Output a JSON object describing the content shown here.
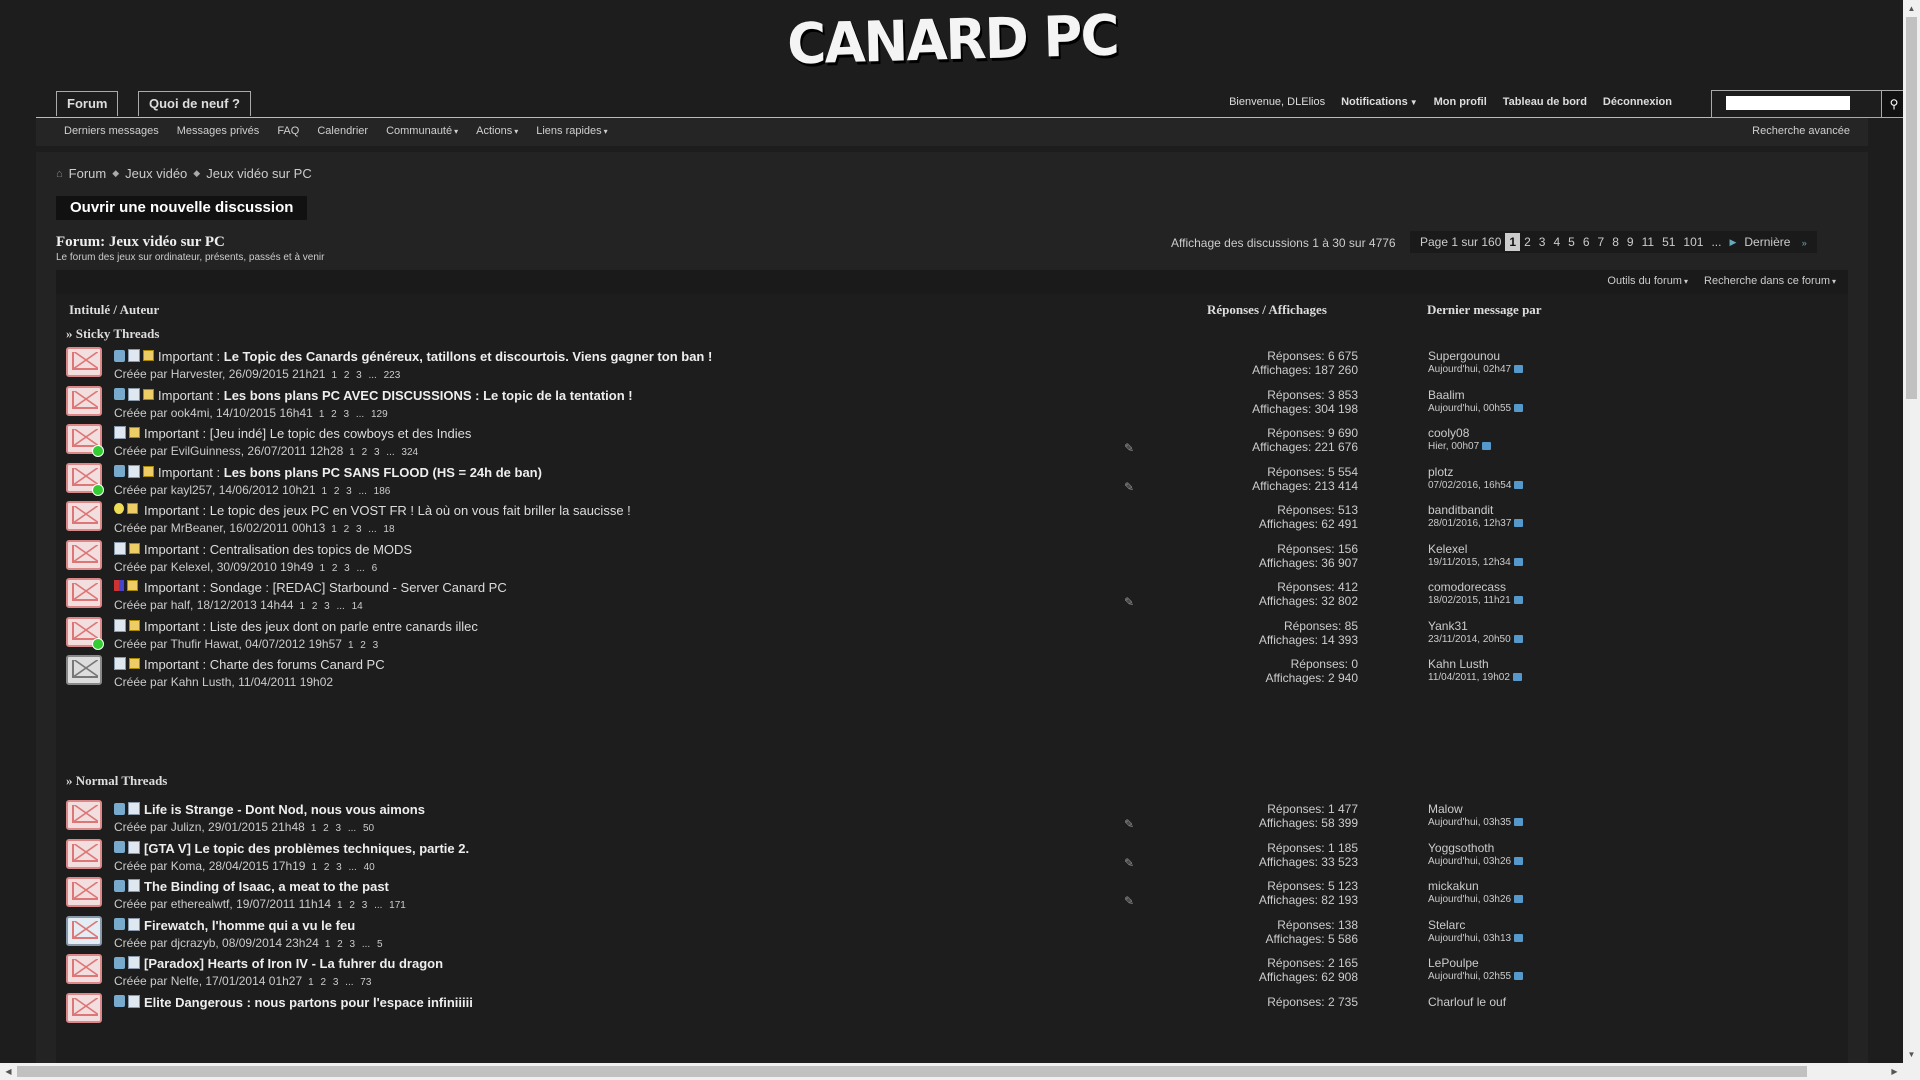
{
  "logo": "CANARD PC",
  "nav": {
    "tabs": [
      "Forum",
      "Quoi de neuf ?"
    ],
    "welcome": "Bienvenue,",
    "username": "DLElios",
    "notifications": "Notifications",
    "profile": "Mon profil",
    "dashboard": "Tableau de bord",
    "logout": "Déconnexion"
  },
  "subnav": {
    "items": [
      "Derniers messages",
      "Messages privés",
      "FAQ",
      "Calendrier",
      "Communauté",
      "Actions",
      "Liens rapides"
    ],
    "advanced_search": "Recherche avancée"
  },
  "breadcrumb": [
    "Forum",
    "Jeux vidéo",
    "Jeux vidéo sur PC"
  ],
  "new_thread_button": "Ouvrir une nouvelle discussion",
  "forum": {
    "title": "Forum: Jeux vidéo sur PC",
    "description": "Le forum des jeux sur ordinateur, présents, passés et à venir",
    "displaying": "Affichage des discussions 1 à 30 sur 4776"
  },
  "pagination": {
    "label": "Page 1 sur 160",
    "pages": [
      "1",
      "2",
      "3",
      "4",
      "5",
      "6",
      "7",
      "8",
      "9",
      "11",
      "51",
      "101"
    ],
    "ellipsis": "...",
    "last": "Dernière"
  },
  "tools": {
    "forum_tools": "Outils du forum",
    "search_forum": "Recherche dans ce forum"
  },
  "columns": {
    "title": "Intitulé / Auteur",
    "stats": "Réponses / Affichages",
    "last": "Dernier message par"
  },
  "sections": {
    "sticky": "» Sticky Threads",
    "normal": "» Normal Threads"
  },
  "sticky_threads": [
    {
      "prefix": "Important : ",
      "title": "Le Topic des Canards généreux, tatillons et discourtois. Viens gagner ton ban !",
      "bold": true,
      "meta": "Créée par Harvester, 26/09/2015 21h21",
      "pages": "1 2 3 ... 223",
      "replies": "Réponses: 6 675",
      "views": "Affichages: 187 260",
      "last_user": "Supergounou",
      "last_time": "Aujourd'hui, 02h47",
      "icons": [
        "sub",
        "doc",
        "yel"
      ],
      "env": "",
      "dot": false,
      "attach": false
    },
    {
      "prefix": "Important : ",
      "title": "Les bons plans PC AVEC DISCUSSIONS : Le topic de la tentation !",
      "bold": true,
      "meta": "Créée par ook4mi, 14/10/2015 16h41",
      "pages": "1 2 3 ... 129",
      "replies": "Réponses: 3 853",
      "views": "Affichages: 304 198",
      "last_user": "Baalim",
      "last_time": "Aujourd'hui, 00h55",
      "icons": [
        "sub",
        "doc",
        "yel"
      ],
      "env": "",
      "dot": false,
      "attach": false
    },
    {
      "prefix": "Important : ",
      "title": "[Jeu indé] Le topic des cowboys et des Indies",
      "bold": false,
      "meta": "Créée par EvilGuinness, 26/07/2011 12h28",
      "pages": "1 2 3 ... 324",
      "replies": "Réponses: 9 690",
      "views": "Affichages: 221 676",
      "last_user": "cooly08",
      "last_time": "Hier, 00h07",
      "icons": [
        "doc",
        "yel"
      ],
      "env": "",
      "dot": true,
      "attach": true
    },
    {
      "prefix": "Important : ",
      "title": "Les bons plans PC SANS FLOOD (HS = 24h de ban)",
      "bold": true,
      "meta": "Créée par kayl257, 14/06/2012 10h21",
      "pages": "1 2 3 ... 186",
      "replies": "Réponses: 5 554",
      "views": "Affichages: 213 414",
      "last_user": "plotz",
      "last_time": "07/02/2016, 16h54",
      "icons": [
        "sub",
        "doc",
        "yel"
      ],
      "env": "",
      "dot": true,
      "attach": true
    },
    {
      "prefix": "Important : ",
      "title": "Le topic des jeux PC en VOST FR ! Là où on vous fait briller la saucisse !",
      "bold": false,
      "meta": "Créée par MrBeaner, 16/02/2011 00h13",
      "pages": "1 2 3 ... 18",
      "replies": "Réponses: 513",
      "views": "Affichages: 62 491",
      "last_user": "banditbandit",
      "last_time": "28/01/2016, 12h37",
      "icons": [
        "bulb",
        "yel"
      ],
      "env": "",
      "dot": false,
      "attach": false
    },
    {
      "prefix": "Important : ",
      "title": "Centralisation des topics de MODS",
      "bold": false,
      "meta": "Créée par Kelexel, 30/09/2010 19h49",
      "pages": "1 2 3 ... 6",
      "replies": "Réponses: 156",
      "views": "Affichages: 36 907",
      "last_user": "Kelexel",
      "last_time": "19/11/2015, 12h34",
      "icons": [
        "doc",
        "yel"
      ],
      "env": "",
      "dot": false,
      "attach": false
    },
    {
      "prefix": "Important : ",
      "title": "Sondage : [REDAC] Starbound - Server Canard PC",
      "bold": false,
      "meta": "Créée par half, 18/12/2013 14h44",
      "pages": "1 2 3 ... 14",
      "replies": "Réponses: 412",
      "views": "Affichages: 32 802",
      "last_user": "comodorecass",
      "last_time": "18/02/2015, 11h21",
      "icons": [
        "flag",
        "yel"
      ],
      "env": "",
      "dot": false,
      "attach": true
    },
    {
      "prefix": "Important : ",
      "title": "Liste des jeux dont on parle entre canards illec",
      "bold": false,
      "meta": "Créée par Thufir Hawat, 04/07/2012 19h57",
      "pages": "1 2 3",
      "replies": "Réponses: 85",
      "views": "Affichages: 14 393",
      "last_user": "Yank31",
      "last_time": "23/11/2014, 20h50",
      "icons": [
        "doc",
        "yel"
      ],
      "env": "",
      "dot": true,
      "attach": false
    },
    {
      "prefix": "Important : ",
      "title": "Charte des forums Canard PC",
      "bold": false,
      "meta": "Créée par Kahn Lusth, 11/04/2011 19h02",
      "pages": "",
      "replies": "Réponses: 0",
      "views": "Affichages: 2 940",
      "last_user": "Kahn Lusth",
      "last_time": "11/04/2011, 19h02",
      "icons": [
        "doc",
        "yel"
      ],
      "env": "locked",
      "dot": false,
      "attach": false
    }
  ],
  "normal_threads": [
    {
      "prefix": "",
      "title": "Life is Strange - Dont Nod, nous vous aimons",
      "bold": true,
      "meta": "Créée par Julizn, 29/01/2015 21h48",
      "pages": "1 2 3 ... 50",
      "replies": "Réponses: 1 477",
      "views": "Affichages: 58 399",
      "last_user": "Malow",
      "last_time": "Aujourd'hui, 03h35",
      "icons": [
        "sub",
        "doc"
      ],
      "env": "",
      "dot": false,
      "attach": true
    },
    {
      "prefix": "",
      "title": "[GTA V] Le topic des problèmes techniques, partie 2.",
      "bold": true,
      "meta": "Créée par Koma, 28/04/2015 17h19",
      "pages": "1 2 3 ... 40",
      "replies": "Réponses: 1 185",
      "views": "Affichages: 33 523",
      "last_user": "Yoggsothoth",
      "last_time": "Aujourd'hui, 03h26",
      "icons": [
        "sub",
        "doc"
      ],
      "env": "",
      "dot": false,
      "attach": true
    },
    {
      "prefix": "",
      "title": "The Binding of Isaac, a meat to the past",
      "bold": true,
      "meta": "Créée par etherealwtf, 19/07/2011 11h14",
      "pages": "1 2 3 ... 171",
      "replies": "Réponses: 5 123",
      "views": "Affichages: 82 193",
      "last_user": "mickakun",
      "last_time": "Aujourd'hui, 03h26",
      "icons": [
        "sub",
        "doc"
      ],
      "env": "",
      "dot": false,
      "attach": true
    },
    {
      "prefix": "",
      "title": "Firewatch, l'homme qui a vu le feu",
      "bold": true,
      "meta": "Créée par djcrazyb, 08/09/2014 23h24",
      "pages": "1 2 3 ... 5",
      "replies": "Réponses: 138",
      "views": "Affichages: 5 586",
      "last_user": "Stelarc",
      "last_time": "Aujourd'hui, 03h13",
      "icons": [
        "sub",
        "doc"
      ],
      "env": "blue",
      "dot": false,
      "attach": false
    },
    {
      "prefix": "",
      "title": "[Paradox] Hearts of Iron IV - La fuhrer du dragon",
      "bold": true,
      "meta": "Créée par Nelfe, 17/01/2014 01h27",
      "pages": "1 2 3 ... 73",
      "replies": "Réponses: 2 165",
      "views": "Affichages: 62 908",
      "last_user": "LePoulpe",
      "last_time": "Aujourd'hui, 02h55",
      "icons": [
        "sub",
        "doc"
      ],
      "env": "",
      "dot": false,
      "attach": false
    },
    {
      "prefix": "",
      "title": "Elite Dangerous : nous partons pour l'espace infiniiiii",
      "bold": true,
      "meta": "",
      "pages": "",
      "replies": "Réponses: 2 735",
      "views": "",
      "last_user": "Charlouf le ouf",
      "last_time": "",
      "icons": [
        "sub",
        "doc"
      ],
      "env": "",
      "dot": false,
      "attach": false
    }
  ]
}
